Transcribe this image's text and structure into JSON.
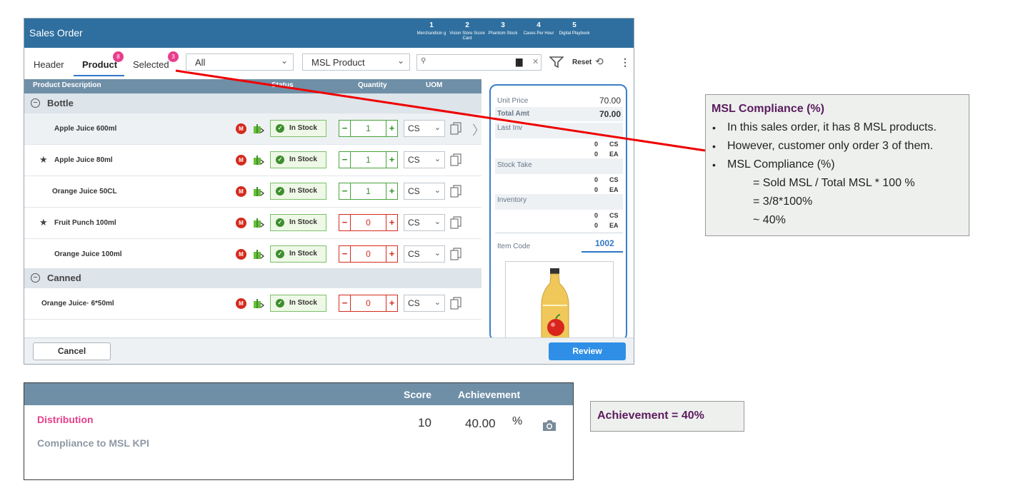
{
  "app": {
    "title": "Sales Order",
    "steps": [
      {
        "num": "1",
        "label": "Merchandisin g"
      },
      {
        "num": "2",
        "label": "Vision Store Score Card"
      },
      {
        "num": "3",
        "label": "Phantom Stock"
      },
      {
        "num": "4",
        "label": "Cases Per Hour"
      },
      {
        "num": "5",
        "label": "Digital Playbook"
      }
    ],
    "tabs": [
      {
        "label": "Header"
      },
      {
        "label": "Product",
        "badge": "8"
      },
      {
        "label": "Selected",
        "badge": "3"
      }
    ],
    "filter_all": "All",
    "filter_msl": "MSL Product",
    "search_placeholder": "",
    "reset_label": "Reset",
    "columns": {
      "desc": "Product Description",
      "status": "Status",
      "quantity": "Quantity",
      "uom": "UOM"
    },
    "groups": [
      {
        "name": "Bottle"
      },
      {
        "name": "Canned"
      }
    ],
    "rows": [
      {
        "name": "Apple Juice 600ml",
        "star": false,
        "msl": "M",
        "status": "In Stock",
        "qty": "1",
        "uom": "CS"
      },
      {
        "name": "Apple Juice 80ml",
        "star": true,
        "msl": "M",
        "status": "In Stock",
        "qty": "1",
        "uom": "CS"
      },
      {
        "name": "Orange Juice  50CL",
        "star": false,
        "msl": "M",
        "status": "In Stock",
        "qty": "1",
        "uom": "CS"
      },
      {
        "name": "Fruit Punch 100ml",
        "star": true,
        "msl": "M",
        "status": "In Stock",
        "qty": "0",
        "uom": "CS"
      },
      {
        "name": "Orange Juice 100ml",
        "star": false,
        "msl": "M",
        "status": "In Stock",
        "qty": "0",
        "uom": "CS"
      },
      {
        "name": "Orange Juice· 6*50ml",
        "star": false,
        "msl": "M",
        "status": "In Stock",
        "qty": "0",
        "uom": "CS"
      }
    ],
    "info": {
      "unit_price_label": "Unit Price",
      "unit_price": "70.00",
      "total_amt_label": "Total Amt",
      "total_amt": "70.00",
      "last_inv_label": "Last Inv",
      "stock_take_label": "Stock Take",
      "inventory_label": "Inventory",
      "zero": "0",
      "cs": "CS",
      "ea": "EA",
      "item_code_label": "Item Code",
      "item_code": "1002"
    },
    "cancel_label": "Cancel",
    "review_label": "Review"
  },
  "callout": {
    "title": "MSL Compliance (%)",
    "bullets": [
      "In this sales order, it has 8 MSL products.",
      "However, customer only order 3 of them.",
      "MSL Compliance (%)"
    ],
    "formula": [
      "= Sold MSL / Total MSL * 100 %",
      "= 3/8*100%",
      "~ 40%"
    ],
    "bullet_char": "•"
  },
  "kpi": {
    "score_header": "Score",
    "achievement_header": "Achievement",
    "category": "Distribution",
    "name": "Compliance to MSL KPI",
    "score": "10",
    "achievement": "40.00",
    "unit": "%"
  },
  "achievement_note": "Achievement = 40%",
  "colors": {
    "header_blue": "#2f6f9f",
    "accent_pink": "#e83e8c",
    "msl_red": "#d52b1e",
    "annotation_purple": "#5a1b5e"
  }
}
